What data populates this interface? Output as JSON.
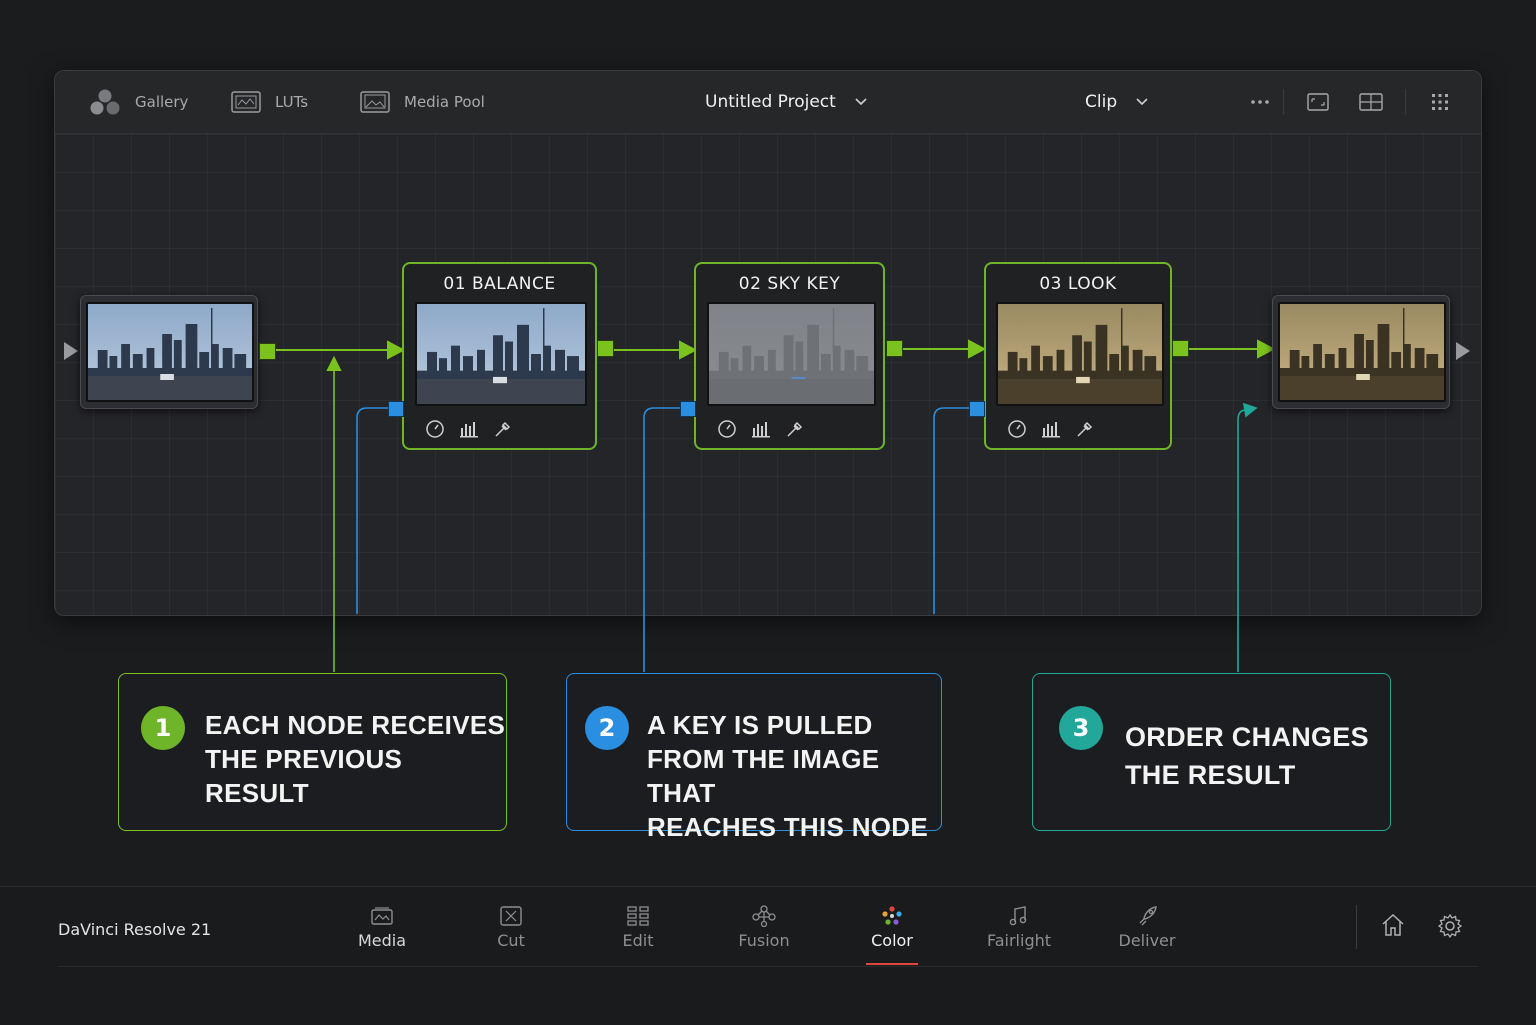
{
  "toolbar": {
    "gallery_label": "Gallery",
    "luts_label": "LUTs",
    "media_pool_label": "Media Pool",
    "project_title": "Untitled Project",
    "clip_label": "Clip",
    "icons": [
      "gallery-icon",
      "luts-icon",
      "media-pool-icon",
      "chevron-down-icon",
      "more-icon",
      "viewer-mode-icon",
      "split-view-icon",
      "grid-menu-icon"
    ]
  },
  "nodes": [
    {
      "title": "01 BALANCE",
      "tools": [
        "dial-icon",
        "histogram-icon",
        "eyedropper-icon"
      ]
    },
    {
      "title": "02 SKY KEY",
      "tools": [
        "dial-icon",
        "histogram-icon",
        "eyedropper-icon"
      ]
    },
    {
      "title": "03 LOOK",
      "tools": [
        "dial-icon",
        "histogram-icon",
        "eyedropper-icon"
      ]
    }
  ],
  "callouts": [
    {
      "number": "1",
      "text": "EACH NODE RECEIVES\nTHE PREVIOUS RESULT",
      "color": "#7cc21f"
    },
    {
      "number": "2",
      "text": "A KEY IS PULLED\nFROM THE IMAGE THAT\nREACHES THIS NODE",
      "color": "#2a8fe0"
    },
    {
      "number": "3",
      "text": "ORDER CHANGES\nTHE RESULT",
      "color": "#22a89a"
    }
  ],
  "bottom": {
    "app_name": "DaVinci Resolve 21",
    "pages": [
      "Media",
      "Cut",
      "Edit",
      "Fusion",
      "Color",
      "Fairlight",
      "Deliver"
    ],
    "active_page": "Color",
    "accent": "#e0463c"
  },
  "colors": {
    "node_border": "#6fb52a",
    "key_line": "#2a8fe0",
    "teal_line": "#22a89a"
  }
}
